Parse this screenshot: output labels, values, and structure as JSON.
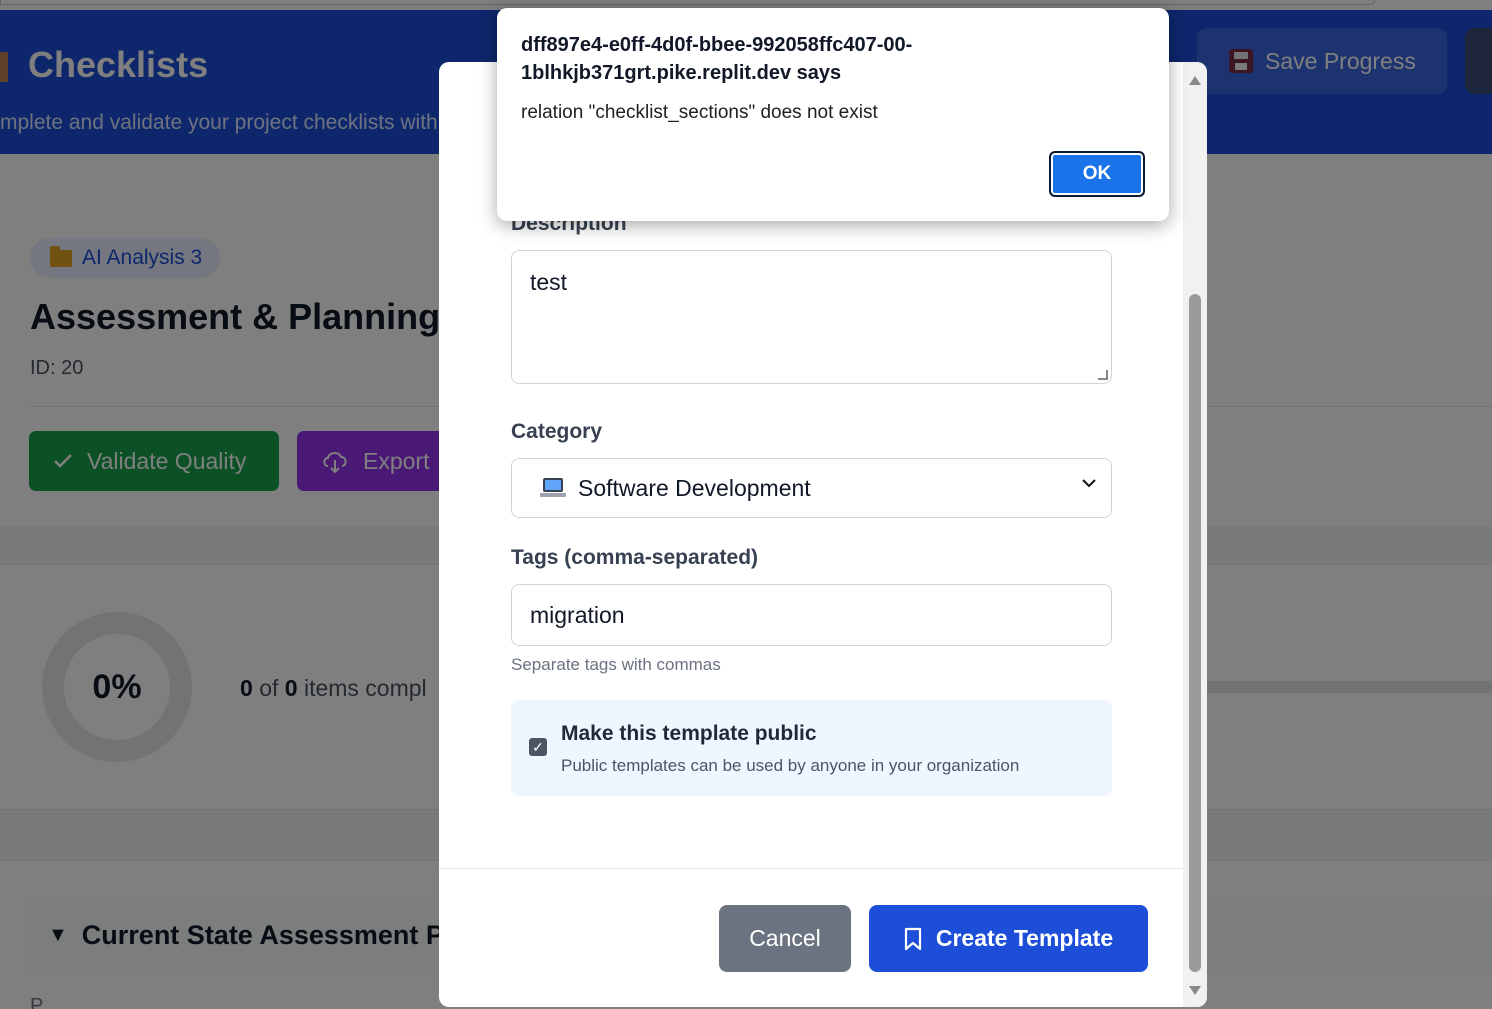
{
  "header": {
    "title": "Checklists",
    "subtitle": "mplete and validate your project checklists with",
    "save_label": "Save Progress"
  },
  "project": {
    "chip_label": "AI Analysis 3",
    "title": "Assessment & Planning",
    "id_label": "ID: 20"
  },
  "actions": {
    "validate_label": "Validate Quality",
    "export_label": "Export"
  },
  "progress": {
    "percent_label": "0%",
    "completed": "0",
    "of_text": "of",
    "total": "0",
    "items_text": "items compl"
  },
  "section": {
    "title": "Current State Assessment Pre",
    "description": "P"
  },
  "modal": {
    "description_label": "Description",
    "description_value": "test",
    "category_label": "Category",
    "category_value": "Software Development",
    "tags_label": "Tags (comma-separated)",
    "tags_value": "migration",
    "tags_hint": "Separate tags with commas",
    "public_title": "Make this template public",
    "public_sub": "Public templates can be used by anyone in your organization",
    "public_checked": true,
    "cancel_label": "Cancel",
    "create_label": "Create Template"
  },
  "alert": {
    "title": "dff897e4-e0ff-4d0f-bbee-992058ffc407-00-1blhkjb371grt.pike.replit.dev says",
    "message": "relation \"checklist_sections\" does not exist",
    "ok_label": "OK"
  },
  "colors": {
    "primary": "#1d4ed8",
    "success": "#16a34a",
    "export": "#9333ea",
    "alert_button": "#1a73e8"
  }
}
